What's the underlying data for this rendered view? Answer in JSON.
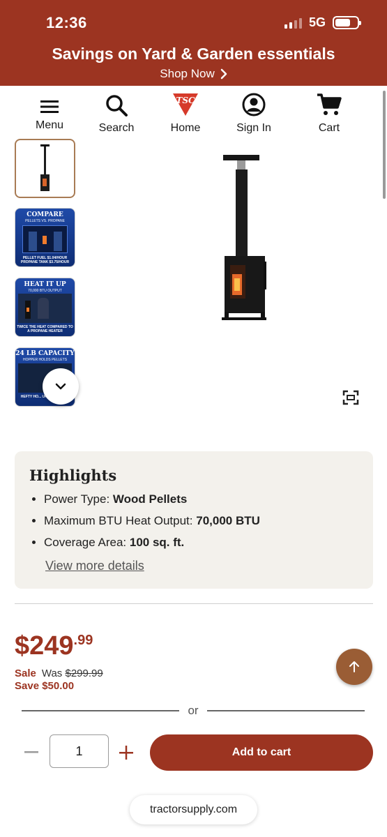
{
  "status_bar": {
    "time": "12:36",
    "network": "5G"
  },
  "promo": {
    "title": "Savings on Yard & Garden essentials",
    "link": "Shop Now",
    "link_icon": "chevron-right-icon"
  },
  "nav": {
    "items": [
      {
        "label": "Menu",
        "icon": "hamburger-menu-icon"
      },
      {
        "label": "Search",
        "icon": "search-icon"
      },
      {
        "label": "Home",
        "icon": "tsc-logo-icon"
      },
      {
        "label": "Sign In",
        "icon": "user-account-icon"
      },
      {
        "label": "Cart",
        "icon": "cart-icon"
      }
    ],
    "logo_text": "TSC"
  },
  "gallery": {
    "thumbnails": [
      {
        "caption": "",
        "sub": ""
      },
      {
        "caption": "COMPARE",
        "sub": "PELLETS VS. PROPANE",
        "footer": "PELLET FUEL $1.04/HOUR PROPANE TANK $3.75/HOUR"
      },
      {
        "caption": "HEAT IT UP",
        "sub": "70,000 BTU OUTPUT",
        "footer": "TWICE THE HEAT COMPARED TO A PROPANE HEATER"
      },
      {
        "caption": "24 LB CAPACITY",
        "sub": "HOPPER HOLDS PELLETS",
        "footer": "HEFTY HO... UP TO 6 HOURS"
      }
    ],
    "scroll_down_icon": "chevron-down-icon",
    "expand_icon": "fullscreen-icon"
  },
  "highlights": {
    "title": "Highlights",
    "items": [
      {
        "label": "Power Type: ",
        "value": "Wood Pellets"
      },
      {
        "label": "Maximum BTU Heat Output: ",
        "value": "70,000 BTU"
      },
      {
        "label": "Coverage Area: ",
        "value": "100 sq. ft."
      }
    ],
    "more_link": "View more details"
  },
  "price": {
    "dollars": "$249",
    "cents": ".99",
    "sale_label": "Sale",
    "was_label": "Was",
    "was_price": "$299.99",
    "save_text": "Save $50.00"
  },
  "purchase": {
    "or_text": "or",
    "quantity": "1",
    "add_to_cart": "Add to cart",
    "minus_icon": "minus-icon",
    "plus_icon": "plus-icon",
    "back_to_top_icon": "arrow-up-icon"
  },
  "browser": {
    "url": "tractorsupply.com"
  },
  "colors": {
    "brand_red": "#9c3421",
    "back_to_top": "#9a5d35",
    "highlight_bg": "#f3f1ec"
  }
}
